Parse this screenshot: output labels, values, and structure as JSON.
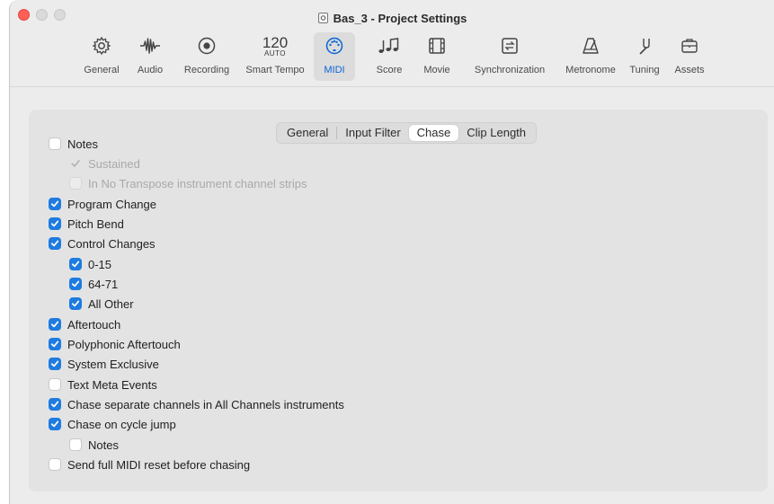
{
  "window": {
    "title": "Bas_3 - Project Settings"
  },
  "toolbar": {
    "items": [
      {
        "label": "General",
        "icon": "gear-icon"
      },
      {
        "label": "Audio",
        "icon": "waveform-icon"
      },
      {
        "label": "Recording",
        "icon": "record-icon"
      },
      {
        "label": "Smart Tempo",
        "icon": "tempo-icon",
        "number": "120",
        "sub": "AUTO"
      },
      {
        "label": "MIDI",
        "icon": "midi-port-icon",
        "selected": true
      },
      {
        "label": "Score",
        "icon": "music-notes-icon"
      },
      {
        "label": "Movie",
        "icon": "film-icon"
      },
      {
        "label": "Synchronization",
        "icon": "sync-icon"
      },
      {
        "label": "Metronome",
        "icon": "metronome-icon"
      },
      {
        "label": "Tuning",
        "icon": "tuning-fork-icon"
      },
      {
        "label": "Assets",
        "icon": "briefcase-icon"
      }
    ]
  },
  "subtabs": [
    {
      "label": "General",
      "active": false
    },
    {
      "label": "Input Filter",
      "active": false
    },
    {
      "label": "Chase",
      "active": true
    },
    {
      "label": "Clip Length",
      "active": false
    }
  ],
  "options": [
    {
      "label": "Notes",
      "checked": false,
      "indent": 0,
      "enabled": true
    },
    {
      "label": "Sustained",
      "checked": true,
      "indent": 1,
      "enabled": false
    },
    {
      "label": "In No Transpose instrument channel strips",
      "checked": false,
      "indent": 1,
      "enabled": false
    },
    {
      "label": "Program Change",
      "checked": true,
      "indent": 0,
      "enabled": true
    },
    {
      "label": "Pitch Bend",
      "checked": true,
      "indent": 0,
      "enabled": true
    },
    {
      "label": "Control Changes",
      "checked": true,
      "indent": 0,
      "enabled": true
    },
    {
      "label": "0-15",
      "checked": true,
      "indent": 1,
      "enabled": true
    },
    {
      "label": "64-71",
      "checked": true,
      "indent": 1,
      "enabled": true
    },
    {
      "label": "All Other",
      "checked": true,
      "indent": 1,
      "enabled": true
    },
    {
      "label": "Aftertouch",
      "checked": true,
      "indent": 0,
      "enabled": true
    },
    {
      "label": "Polyphonic Aftertouch",
      "checked": true,
      "indent": 0,
      "enabled": true
    },
    {
      "label": "System Exclusive",
      "checked": true,
      "indent": 0,
      "enabled": true
    },
    {
      "label": "Text Meta Events",
      "checked": false,
      "indent": 0,
      "enabled": true
    },
    {
      "label": "Chase separate channels in All Channels instruments",
      "checked": true,
      "indent": 0,
      "enabled": true
    },
    {
      "label": "Chase on cycle jump",
      "checked": true,
      "indent": 0,
      "enabled": true
    },
    {
      "label": "Notes",
      "checked": false,
      "indent": 1,
      "enabled": true
    },
    {
      "label": "Send full MIDI reset before chasing",
      "checked": false,
      "indent": 0,
      "enabled": true
    }
  ],
  "colors": {
    "accent": "#1e7be0",
    "selected_label": "#0a64d6"
  }
}
